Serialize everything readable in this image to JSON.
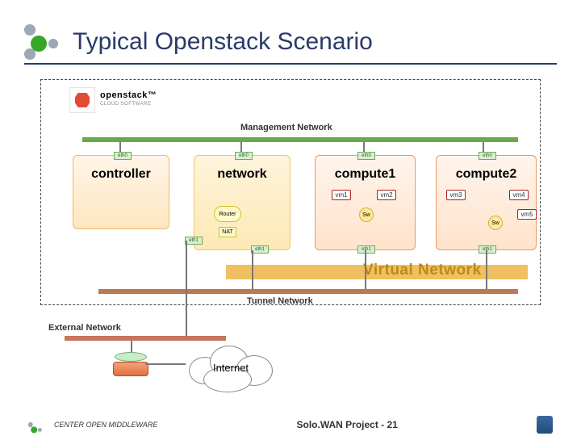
{
  "title": "Typical Openstack Scenario",
  "logo": {
    "line1": "openstack™",
    "line2": "CLOUD SOFTWARE"
  },
  "networks": {
    "management": "Management Network",
    "tunnel": "Tunnel Network",
    "external": "External Network",
    "virtual": "Virtual Network"
  },
  "nodes": {
    "controller": "controller",
    "network": "network",
    "compute1": "compute1",
    "compute2": "compute2"
  },
  "ports": {
    "eth0": "eth0",
    "eth1": "eth1"
  },
  "vms": {
    "vm1": "vm1",
    "vm2": "vm2",
    "vm3": "vm3",
    "vm4": "vm4",
    "vm5": "vm5"
  },
  "devices": {
    "router": "Router",
    "nat": "NAT",
    "sw": "Sw"
  },
  "cloud": "Internet",
  "footer": {
    "left": "CENTER OPEN MIDDLEWARE",
    "center_prefix": "Solo.WAN Project - ",
    "page": "21"
  },
  "colors": {
    "mgmt": "#6aa84f",
    "tunnel": "#b97a56",
    "external": "#c8745e",
    "virtual": "#f0c060"
  }
}
